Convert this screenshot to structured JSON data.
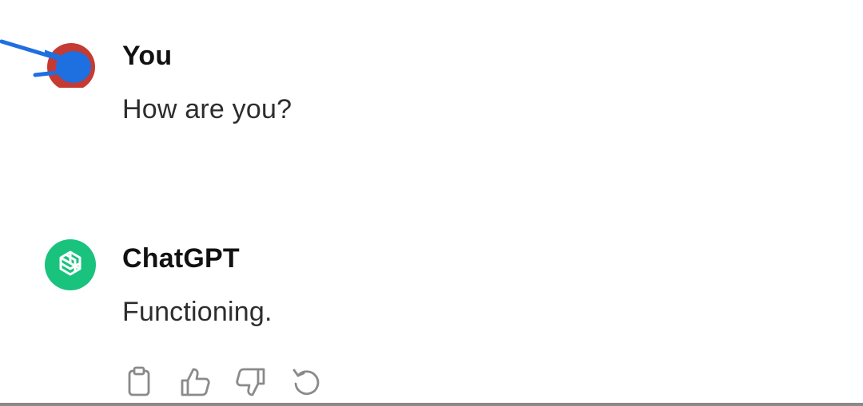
{
  "conversation": {
    "user_message": {
      "author": "You",
      "text": "How are you?",
      "avatar": {
        "icon": "user-avatar-icon",
        "colors": {
          "outer": "#c53a32",
          "inner": "#1e6fe0"
        }
      }
    },
    "assistant_message": {
      "author": "ChatGPT",
      "text": "Functioning.",
      "avatar": {
        "icon": "openai-logo-icon",
        "colors": {
          "background": "#19c37d",
          "foreground": "#ffffff"
        }
      }
    },
    "actions": [
      {
        "icon": "copy-icon"
      },
      {
        "icon": "thumbs-up-icon"
      },
      {
        "icon": "thumbs-down-icon"
      },
      {
        "icon": "regenerate-icon"
      }
    ]
  },
  "colors": {
    "icon_gray": "#8a8a8a",
    "text": "#2d2d2d",
    "author": "#111111"
  }
}
